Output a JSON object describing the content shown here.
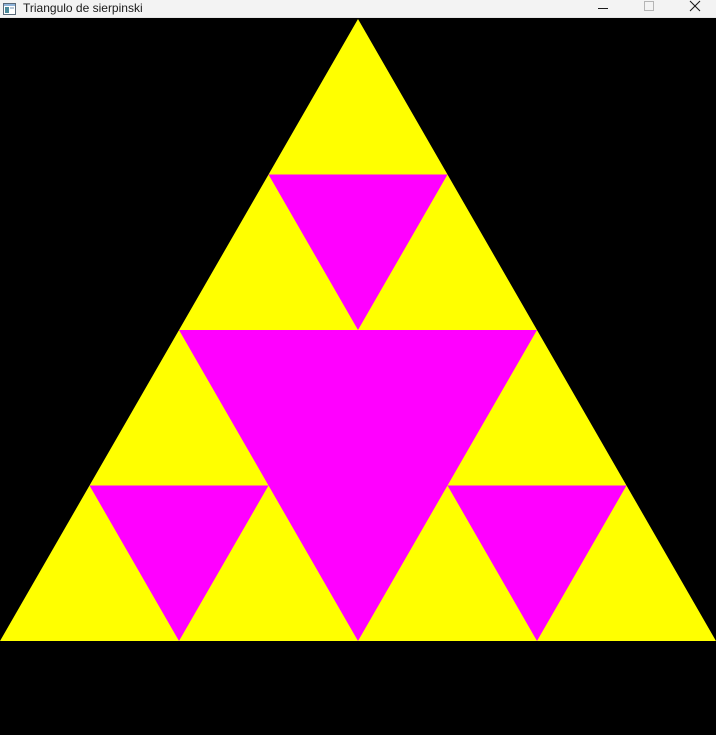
{
  "window": {
    "title": "Triangulo de sierpinski",
    "icon": "app-window-icon",
    "controls": [
      {
        "name": "minimize-button",
        "icon": "minimize-icon"
      },
      {
        "name": "maximize-button",
        "icon": "maximize-icon"
      },
      {
        "name": "close-button",
        "icon": "close-icon"
      }
    ]
  },
  "canvas": {
    "background_color": "#000000",
    "fill_color": "#ffff00",
    "hole_color": "#ff00ff",
    "recursion_depth": 2
  }
}
